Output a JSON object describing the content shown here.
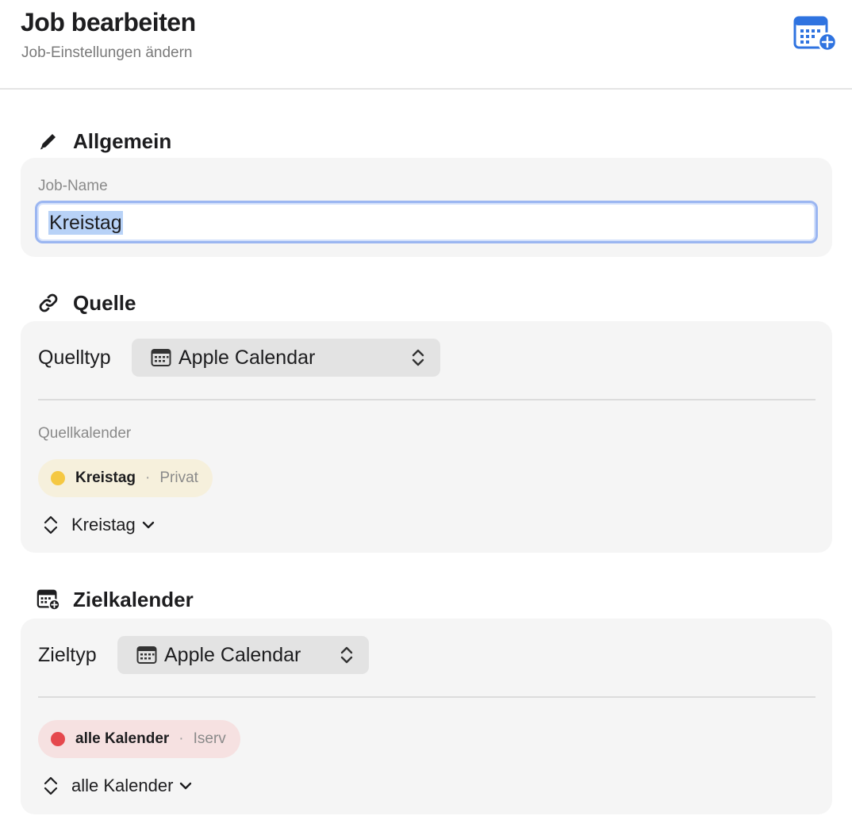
{
  "header": {
    "title": "Job bearbeiten",
    "subtitle": "Job-Einstellungen ändern",
    "action_icon": "calendar-add-icon"
  },
  "allgemein": {
    "heading": "Allgemein",
    "icon": "pencil-icon",
    "field_label": "Job-Name",
    "field_value": "Kreistag"
  },
  "quelle": {
    "heading": "Quelle",
    "icon": "link-icon",
    "type_label": "Quelltyp",
    "type_value": "Apple Calendar",
    "calendar_label": "Quellkalender",
    "chip": {
      "name": "Kreistag",
      "separator": "·",
      "account": "Privat",
      "color": "#f5c842",
      "background": "#f6f0dc"
    },
    "picker_value": "Kreistag"
  },
  "ziel": {
    "heading": "Zielkalender",
    "icon": "calendar-add-icon",
    "type_label": "Zieltyp",
    "type_value": "Apple Calendar",
    "chip": {
      "name": "alle Kalender",
      "separator": "·",
      "account": "Iserv",
      "color": "#e5484d",
      "background": "#f6e1e1"
    },
    "picker_value": "alle Kalender"
  },
  "colors": {
    "accent": "#2f73e0",
    "focus_ring": "#9bb6f1",
    "selection": "#b8d2f7"
  }
}
